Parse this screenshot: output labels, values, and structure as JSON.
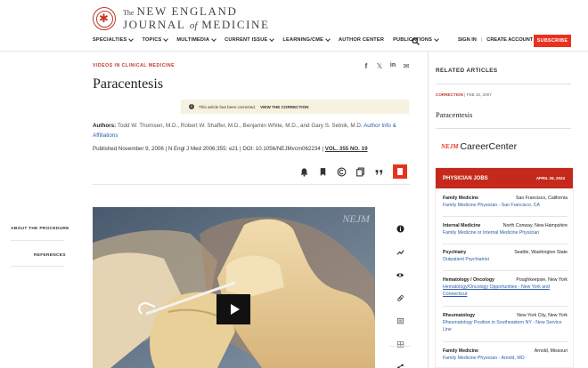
{
  "brand": {
    "the": "The",
    "line1": "NEW ENGLAND",
    "line2a": "JOURNAL",
    "line2b": "of",
    "line2c": "MEDICINE",
    "accent": "#e8321f"
  },
  "nav": {
    "items": [
      "SPECIALTIES",
      "TOPICS",
      "MULTIMEDIA",
      "CURRENT ISSUE",
      "LEARNING/CME",
      "AUTHOR CENTER",
      "PUBLICATIONS"
    ],
    "signin": "SIGN IN",
    "create": "CREATE ACCOUNT",
    "subscribe": "SUBSCRIBE"
  },
  "article": {
    "kicker": "VIDEOS IN CLINICAL MEDICINE",
    "title": "Paracentesis",
    "correction_text": "This article has been corrected.",
    "correction_link": "VIEW THE CORRECTION",
    "authors_label": "Authors:",
    "authors": "Todd W. Thomsen, M.D., Robert W. Shaffer, M.D., Benjamin White, M.D., and Gary S. Setnik, M.D.",
    "affiliations": "Author Info & Affiliations",
    "published": "Published November 9, 2006 | N Engl J Med 2006;355: e21 | DOI: 10.1056/NEJMvcm062234 |",
    "volume": "VOL. 355 NO. 19"
  },
  "sidebar": {
    "about": "ABOUT THE PROCEDURE",
    "references": "REFERENCES"
  },
  "video": {
    "watermark": "NEJM"
  },
  "related": {
    "heading": "RELATED ARTICLES",
    "tag": "CORRECTION",
    "date": "FEB 15, 2007",
    "title": "Paracentesis"
  },
  "career": {
    "nejm": "NEJM",
    "name": "CareerCenter",
    "banner": "PHYSICIAN JOBS",
    "date": "APRIL 26, 2024",
    "jobs": [
      {
        "spec": "Family Medicine",
        "loc": "San Francisco, California",
        "title": "Family Medicine Physician - San Francisco, CA"
      },
      {
        "spec": "Internal Medicine",
        "loc": "North Conway, New Hampshire",
        "title": "Family Medicine or Internal Medicine Physician"
      },
      {
        "spec": "Psychiatry",
        "loc": "Seattle, Washington State",
        "title": "Outpatient Psychiatrist"
      },
      {
        "spec": "Hematology / Oncology",
        "loc": "Poughkeepsie, New York",
        "title": "Hematology/Oncology Opportunities - New York and Connecticut"
      },
      {
        "spec": "Rheumatology",
        "loc": "New York City, New York",
        "title": "Rheumatology Position in Southeastern NY - New Service Line"
      },
      {
        "spec": "Family Medicine",
        "loc": "Arnold, Missouri",
        "title": "Family Medicine Physician - Arnold, MO"
      }
    ]
  },
  "icons": {
    "share": [
      "facebook-icon",
      "x-icon",
      "linkedin-icon",
      "email-icon"
    ],
    "tools": [
      "alert-bell-icon",
      "bookmark-icon",
      "copyright-icon",
      "copy-icon",
      "quote-icon",
      "pdf-icon"
    ],
    "video_tools": [
      "info-icon",
      "trending-icon",
      "eye-icon",
      "link-icon",
      "comment-icon",
      "grid-icon",
      "share-icon"
    ]
  }
}
